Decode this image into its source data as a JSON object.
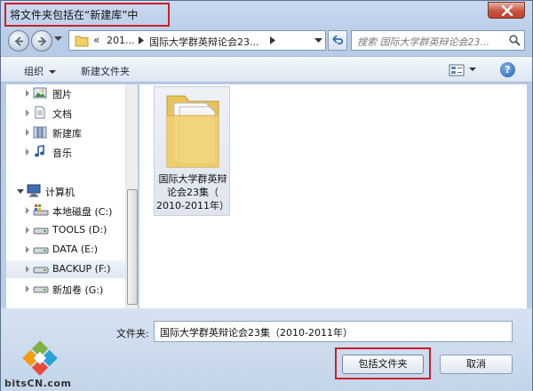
{
  "window": {
    "title": "将文件夹包括在“新建库”中"
  },
  "address_bar": {
    "overflow_chevron": "«",
    "segments": [
      "201...",
      "国际大学群英辩论会23..."
    ]
  },
  "search": {
    "placeholder": "搜索 国际大学群英辩论会23..."
  },
  "toolbar": {
    "organize_label": "组织",
    "new_folder_label": "新建文件夹",
    "help_label": "?"
  },
  "nav_tree": {
    "libraries": [
      {
        "label": "图片",
        "icon": "pictures-library-icon"
      },
      {
        "label": "文档",
        "icon": "documents-library-icon"
      },
      {
        "label": "新建库",
        "icon": "new-library-icon"
      },
      {
        "label": "音乐",
        "icon": "music-library-icon"
      }
    ],
    "computer_label": "计算机",
    "drives": [
      {
        "label": "本地磁盘 (C:)",
        "icon": "system-drive-icon"
      },
      {
        "label": "TOOLS (D:)",
        "icon": "drive-icon"
      },
      {
        "label": "DATA (E:)",
        "icon": "drive-icon"
      },
      {
        "label": "BACKUP (F:)",
        "icon": "drive-icon",
        "selected": true
      },
      {
        "label": "新加卷 (G:)",
        "icon": "drive-icon"
      }
    ]
  },
  "content": {
    "folder_item": {
      "line1": "国际大学群英辩",
      "line2": "论会23集（",
      "line3": "2010-2011年）"
    }
  },
  "footer": {
    "folder_label": "文件夹:",
    "folder_value": "国际大学群英辩论会23集（2010-2011年）",
    "include_button": "包括文件夹",
    "cancel_button": "取消"
  },
  "watermark": {
    "text": "bitsCN.com"
  },
  "colors": {
    "highlight_red": "#c8202a",
    "window_frame": "#b9cde8",
    "close_red": "#c8553f"
  }
}
